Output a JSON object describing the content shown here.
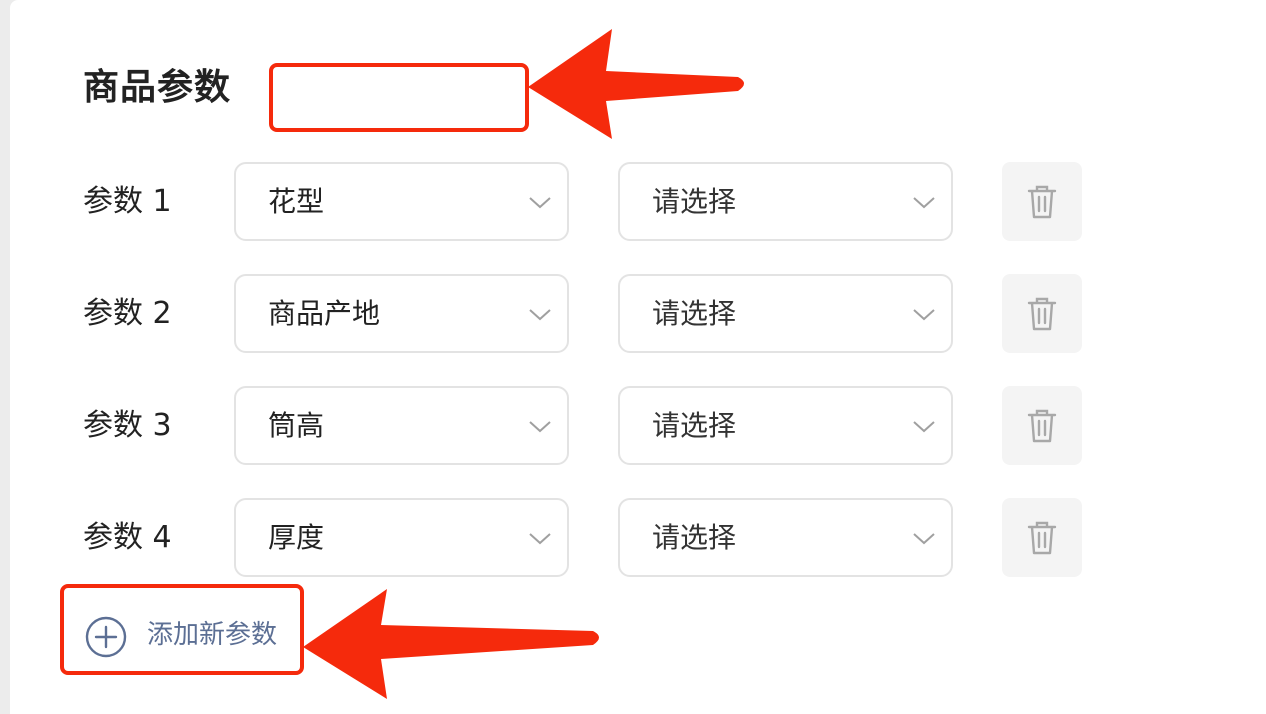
{
  "section": {
    "title": "商品参数"
  },
  "params": [
    {
      "label": "参数 1",
      "name": "花型",
      "value_placeholder": "请选择"
    },
    {
      "label": "参数 2",
      "name": "商品产地",
      "value_placeholder": "请选择"
    },
    {
      "label": "参数 3",
      "name": "筒高",
      "value_placeholder": "请选择"
    },
    {
      "label": "参数 4",
      "name": "厚度",
      "value_placeholder": "请选择"
    }
  ],
  "add_param": {
    "label": "添加新参数"
  },
  "icons": {
    "select_arrow": "chevron-down-icon",
    "delete": "trash-icon",
    "add": "plus-circle-icon",
    "annotation": "arrow-icon"
  },
  "colors": {
    "annotation_red": "#f52a0c",
    "add_link": "#5c6f94",
    "delete_bg": "#f4f4f4",
    "border": "#e3e3e3"
  }
}
